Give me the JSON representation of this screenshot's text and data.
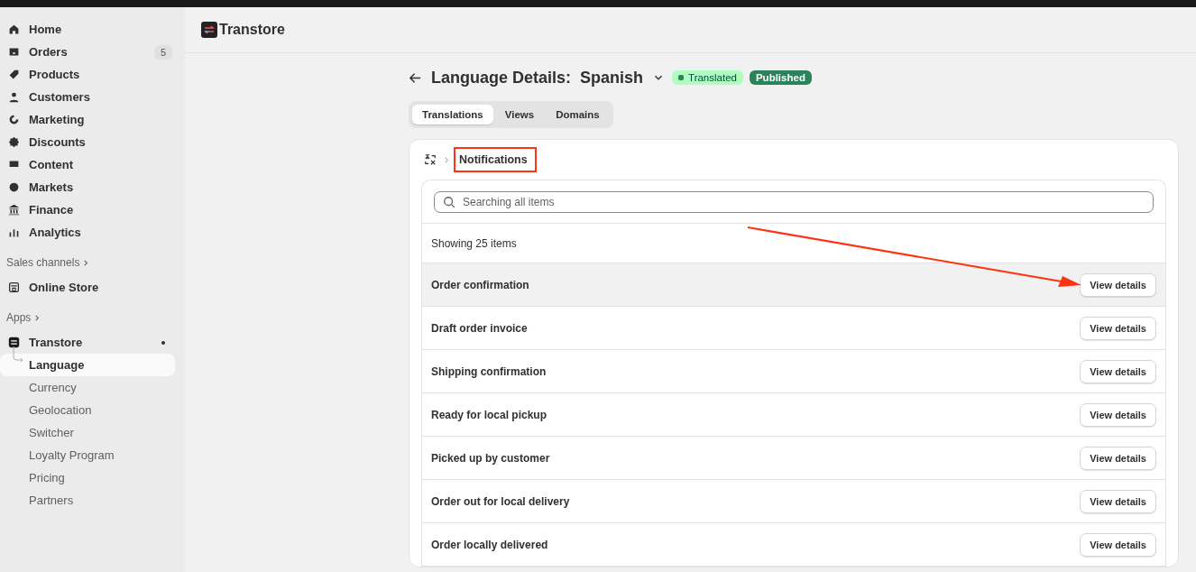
{
  "sidebar": {
    "items": [
      {
        "label": "Home",
        "selected": false
      },
      {
        "label": "Orders",
        "badge": "5",
        "selected": false
      },
      {
        "label": "Products",
        "selected": false
      },
      {
        "label": "Customers",
        "selected": false
      },
      {
        "label": "Marketing",
        "selected": false
      },
      {
        "label": "Discounts",
        "selected": false
      },
      {
        "label": "Content",
        "selected": false
      },
      {
        "label": "Markets",
        "selected": false
      },
      {
        "label": "Finance",
        "selected": false
      },
      {
        "label": "Analytics",
        "selected": false
      }
    ],
    "sales_channels": {
      "heading": "Sales channels",
      "items": [
        {
          "label": "Online Store",
          "selected": false
        }
      ]
    },
    "apps": {
      "heading": "Apps",
      "app": {
        "label": "Transtore",
        "pinned": true,
        "children": [
          {
            "label": "Language",
            "selected": true
          },
          {
            "label": "Currency",
            "selected": false
          },
          {
            "label": "Geolocation",
            "selected": false
          },
          {
            "label": "Switcher",
            "selected": false
          },
          {
            "label": "Loyalty Program",
            "selected": false
          },
          {
            "label": "Pricing",
            "selected": false
          },
          {
            "label": "Partners",
            "selected": false
          }
        ]
      }
    }
  },
  "header": {
    "app_name": "Transtore"
  },
  "page": {
    "title": "Language Details:  Spanish",
    "badges": [
      {
        "label": "Translated",
        "kind": "status"
      },
      {
        "label": "Published",
        "kind": "solid"
      }
    ],
    "tabs": [
      {
        "label": "Translations",
        "selected": true
      },
      {
        "label": "Views",
        "selected": false
      },
      {
        "label": "Domains",
        "selected": false
      }
    ],
    "breadcrumb": {
      "label": "Notifications",
      "highlighted": true
    },
    "search": {
      "placeholder": "Searching all items"
    },
    "count": "Showing 25 items",
    "rows": [
      {
        "name": "Order confirmation",
        "button": "View details",
        "selected": true,
        "pointed": true
      },
      {
        "name": "Draft order invoice",
        "button": "View details",
        "selected": false,
        "pointed": false
      },
      {
        "name": "Shipping confirmation",
        "button": "View details",
        "selected": false,
        "pointed": false
      },
      {
        "name": "Ready for local pickup",
        "button": "View details",
        "selected": false,
        "pointed": false
      },
      {
        "name": "Picked up by customer",
        "button": "View details",
        "selected": false,
        "pointed": false
      },
      {
        "name": "Order out for local delivery",
        "button": "View details",
        "selected": false,
        "pointed": false
      },
      {
        "name": "Order locally delivered",
        "button": "View details",
        "selected": false,
        "pointed": false
      }
    ]
  }
}
